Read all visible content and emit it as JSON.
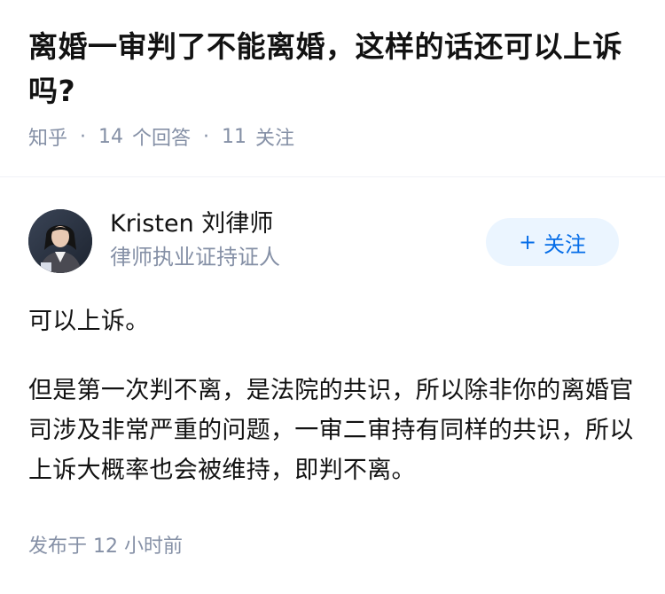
{
  "question": {
    "title": "离婚一审判了不能离婚，这样的话还可以上诉吗?",
    "source": "知乎",
    "answer_count": "14",
    "answer_label": "个回答",
    "follower_count": "11",
    "follower_label": "关注",
    "separator": "·"
  },
  "answer": {
    "author": {
      "name": "Kristen 刘律师",
      "badge": "律师执业证持证人",
      "follow_label": "关注",
      "follow_icon": "plus-icon"
    },
    "paragraphs": [
      "可以上诉。",
      "但是第一次判不离，是法院的共识，所以除非你的离婚官司涉及非常严重的问题，一审二审持有同样的共识，所以上诉大概率也会被维持，即判不离。"
    ],
    "posted_label": "发布于",
    "posted_time": "12 小时前"
  },
  "colors": {
    "meta_text": "#8590a6",
    "accent": "#056de8",
    "follow_bg": "#ebf5ff",
    "primary_text": "#121212"
  }
}
